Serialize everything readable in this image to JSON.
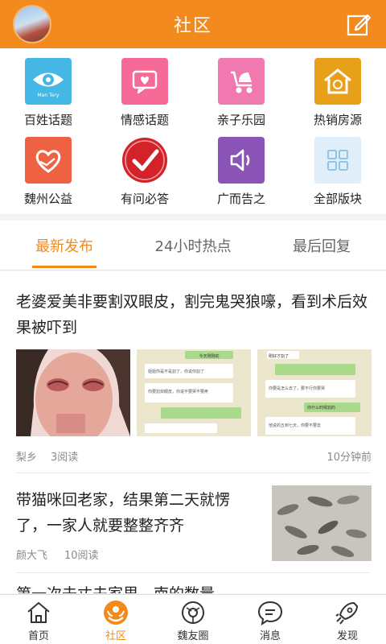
{
  "header": {
    "title": "社区",
    "avatar": "user-avatar",
    "edit_icon": "edit-icon"
  },
  "categories": [
    {
      "label": "百姓话题",
      "icon": "eye-icon",
      "color": "#45b8e8",
      "icon_text": "Man Tery"
    },
    {
      "label": "情感话题",
      "icon": "heart-chat-icon",
      "color": "#f56a96"
    },
    {
      "label": "亲子乐园",
      "icon": "stroller-icon",
      "color": "#f07ab0"
    },
    {
      "label": "热销房源",
      "icon": "house-icon",
      "color": "#e8a019"
    },
    {
      "label": "魏州公益",
      "icon": "heart-hand-icon",
      "color": "#ef6143"
    },
    {
      "label": "有问必答",
      "icon": "check-icon",
      "color": "#d4222a"
    },
    {
      "label": "广而告之",
      "icon": "speaker-icon",
      "color": "#8b55b8"
    },
    {
      "label": "全部版块",
      "icon": "grid-icon",
      "color": "#dfeef9"
    }
  ],
  "tabs": [
    {
      "label": "最新发布"
    },
    {
      "label": "24小时热点"
    },
    {
      "label": "最后回复"
    }
  ],
  "articles": [
    {
      "title": "老婆爱美非要割双眼皮，割完鬼哭狼嚎，看到术后效果被吓到",
      "author": "梨乡",
      "reads": "3阅读",
      "time": "10分钟前",
      "chat_shot_1": [
        "今天刚刚的",
        "姐姐你是不是割了，你说你割了",
        "你要割双眼皮，你说不要哭不要疼"
      ],
      "chat_shot_2": [
        "刚好才割了",
        "你要是怎么去了，要不行你要哭",
        "你什么时候割的",
        "他说的五到七天，你要不要去"
      ]
    },
    {
      "title": "带猫咪回老家，结果第二天就愣了，一家人就要整整齐齐",
      "author": "颜大飞",
      "reads": "10阅读"
    },
    {
      "title": "第一次去丈夫家里，南的数量"
    }
  ],
  "bottom_nav": [
    {
      "label": "首页",
      "icon": "home-icon"
    },
    {
      "label": "社区",
      "icon": "community-icon",
      "active": true
    },
    {
      "label": "魏友圈",
      "icon": "circle-icon"
    },
    {
      "label": "消息",
      "icon": "message-icon"
    },
    {
      "label": "发现",
      "icon": "rocket-icon"
    }
  ],
  "colors": {
    "accent": "#f28a1e"
  }
}
